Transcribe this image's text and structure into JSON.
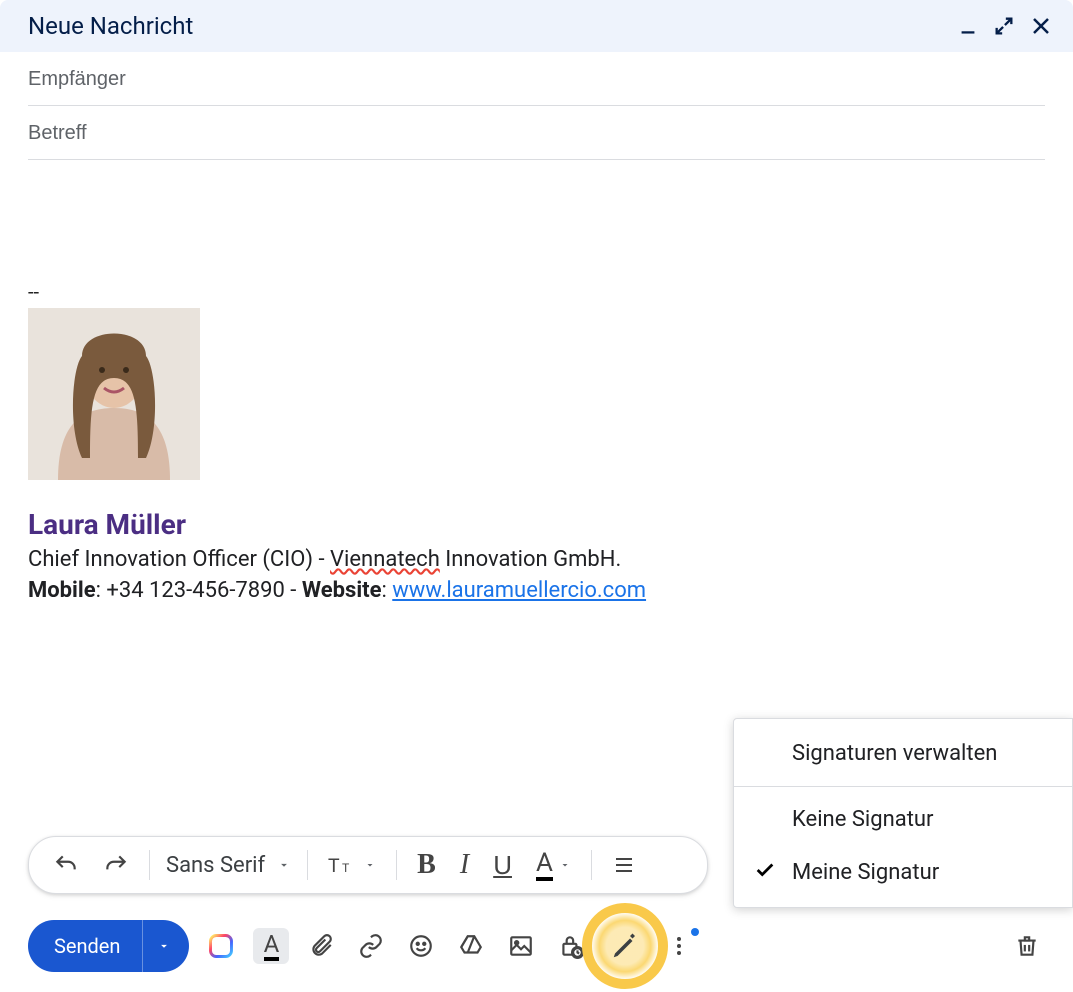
{
  "header": {
    "title": "Neue Nachricht"
  },
  "fields": {
    "recipients_placeholder": "Empfänger",
    "subject_placeholder": "Betreff"
  },
  "signature": {
    "divider": "--",
    "name": "Laura Müller",
    "title_prefix": "Chief Innovation Officer (CIO) - ",
    "title_company_spellchecked": "Viennatech",
    "title_suffix": " Innovation GmbH.",
    "mobile_label": "Mobile",
    "mobile_value": ": +34 123-456-7890  - ",
    "website_label": "Website",
    "website_sep": ": ",
    "website_url_text": "www.lauramuellercio.com"
  },
  "toolbar": {
    "font": "Sans Serif"
  },
  "send": {
    "label": "Senden"
  },
  "popup": {
    "manage": "Signaturen verwalten",
    "none": "Keine Signatur",
    "mine": "Meine Signatur"
  }
}
